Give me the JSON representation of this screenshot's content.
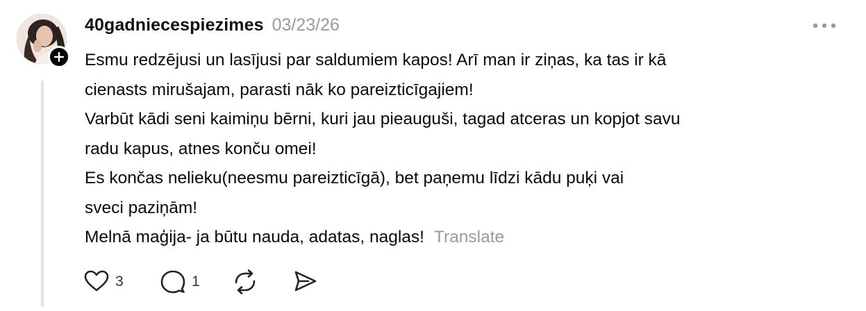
{
  "post": {
    "username": "40gadniecespiezimes",
    "timestamp": "03/23/26",
    "lines": [
      "Esmu redzējusi un lasījusi par saldumiem kapos! Arī man ir ziņas, ka tas ir kā",
      "cienasts mirušajam, parasti nāk ko pareizticīgajiem!",
      "Varbūt kādi seni kaimiņu bērni, kuri jau pieauguši, tagad atceras un kopjot savu",
      "radu kapus, atnes konču omei!",
      "Es končas nelieku(neesmu pareizticīgā), bet paņemu līdzi kādu puķi vai",
      "sveci paziņām!",
      "Melnā maģija- ja būtu nauda, adatas, naglas!"
    ],
    "translate_label": "Translate"
  },
  "actions": {
    "like_count": "3",
    "reply_count": "1"
  },
  "icons": {
    "follow": "plus-icon",
    "more": "more-horizontal-icon",
    "like": "heart-icon",
    "reply": "comment-icon",
    "repost": "repost-icon",
    "share": "send-icon"
  },
  "colors": {
    "text": "#0a0a0a",
    "muted": "#9b9b9b",
    "thread_line": "#e2e2e2",
    "badge": "#000000"
  }
}
